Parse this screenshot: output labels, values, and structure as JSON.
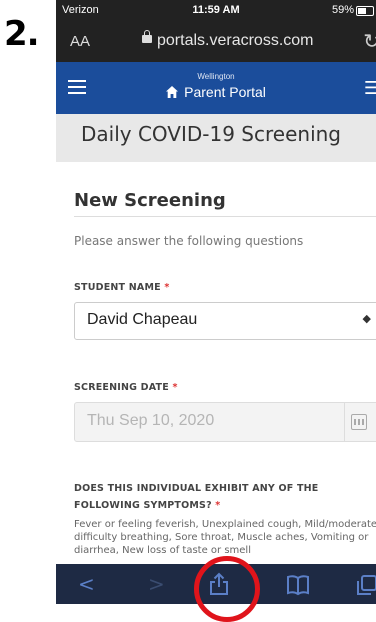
{
  "step_label": "2.",
  "status_bar": {
    "carrier": "Verizon",
    "time": "11:59 AM",
    "battery": "59%"
  },
  "browser": {
    "text_size_label": "AA",
    "url": "portals.veracross.com"
  },
  "portal": {
    "school": "Wellington",
    "title": "Parent Portal"
  },
  "page": {
    "title": "Daily COVID-19 Screening"
  },
  "form": {
    "section_title": "New Screening",
    "instructions": "Please answer the following questions",
    "student": {
      "label": "STUDENT NAME",
      "required_mark": "*",
      "value": "David Chapeau"
    },
    "date": {
      "label": "SCREENING DATE",
      "required_mark": "*",
      "value": "Thu Sep 10, 2020"
    },
    "question": {
      "label": "DOES THIS INDIVIDUAL EXHIBIT ANY OF THE FOLLOWING SYMPTOMS?",
      "required_mark": "*",
      "symptoms": "Fever or feeling feverish, Unexplained cough, Mild/moderate difficulty breathing, Sore throat, Muscle aches, Vomiting or diarrhea, New loss of taste or smell"
    }
  },
  "toolbar": {
    "icons": [
      "back-icon",
      "forward-icon",
      "share-icon",
      "bookmarks-icon",
      "tabs-icon"
    ]
  },
  "colors": {
    "header_blue": "#1b4d9b",
    "highlight_red": "#e0141b",
    "toolbar_bg": "#1e2a44"
  }
}
